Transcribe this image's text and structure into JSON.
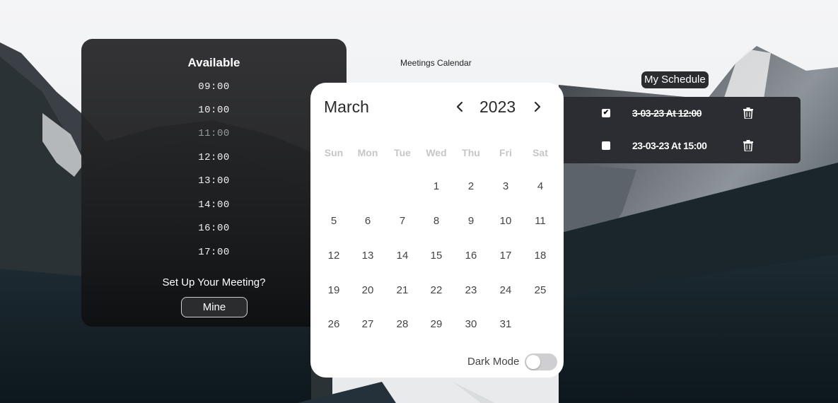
{
  "available": {
    "title": "Available",
    "slots": [
      {
        "time": "09:00",
        "dimmed": false
      },
      {
        "time": "10:00",
        "dimmed": false
      },
      {
        "time": "11:00",
        "dimmed": true
      },
      {
        "time": "12:00",
        "dimmed": false
      },
      {
        "time": "13:00",
        "dimmed": false
      },
      {
        "time": "14:00",
        "dimmed": false
      },
      {
        "time": "16:00",
        "dimmed": false
      },
      {
        "time": "17:00",
        "dimmed": false
      }
    ],
    "setup_prompt": "Set Up Your Meeting?",
    "mine_button": "Mine"
  },
  "header": {
    "title": "Meetings Calendar"
  },
  "schedule": {
    "label": "My Schedule",
    "items": [
      {
        "text": "3-03-23 At 12:00",
        "checked": true,
        "done": true,
        "delete_icon": "trash-icon"
      },
      {
        "text": "23-03-23 At 15:00",
        "checked": false,
        "done": false,
        "delete_icon": "trash-icon"
      }
    ]
  },
  "calendar": {
    "month": "March",
    "year": "2023",
    "prev_icon": "chevron-left-icon",
    "next_icon": "chevron-right-icon",
    "weekdays": [
      "Sun",
      "Mon",
      "Tue",
      "Wed",
      "Thu",
      "Fri",
      "Sat"
    ],
    "first_weekday_index": 3,
    "days": [
      "1",
      "2",
      "3",
      "4",
      "5",
      "6",
      "7",
      "8",
      "9",
      "10",
      "11",
      "12",
      "13",
      "14",
      "15",
      "16",
      "17",
      "18",
      "19",
      "20",
      "21",
      "22",
      "23",
      "24",
      "25",
      "26",
      "27",
      "28",
      "29",
      "30",
      "31"
    ],
    "dark_mode_label": "Dark Mode",
    "dark_mode_on": false
  },
  "colors": {
    "panel_dark": "#2c2d33",
    "calendar_bg": "#ffffff",
    "weekday_text": "#c6c6c6",
    "toggle_off": "#cfcfd2"
  }
}
